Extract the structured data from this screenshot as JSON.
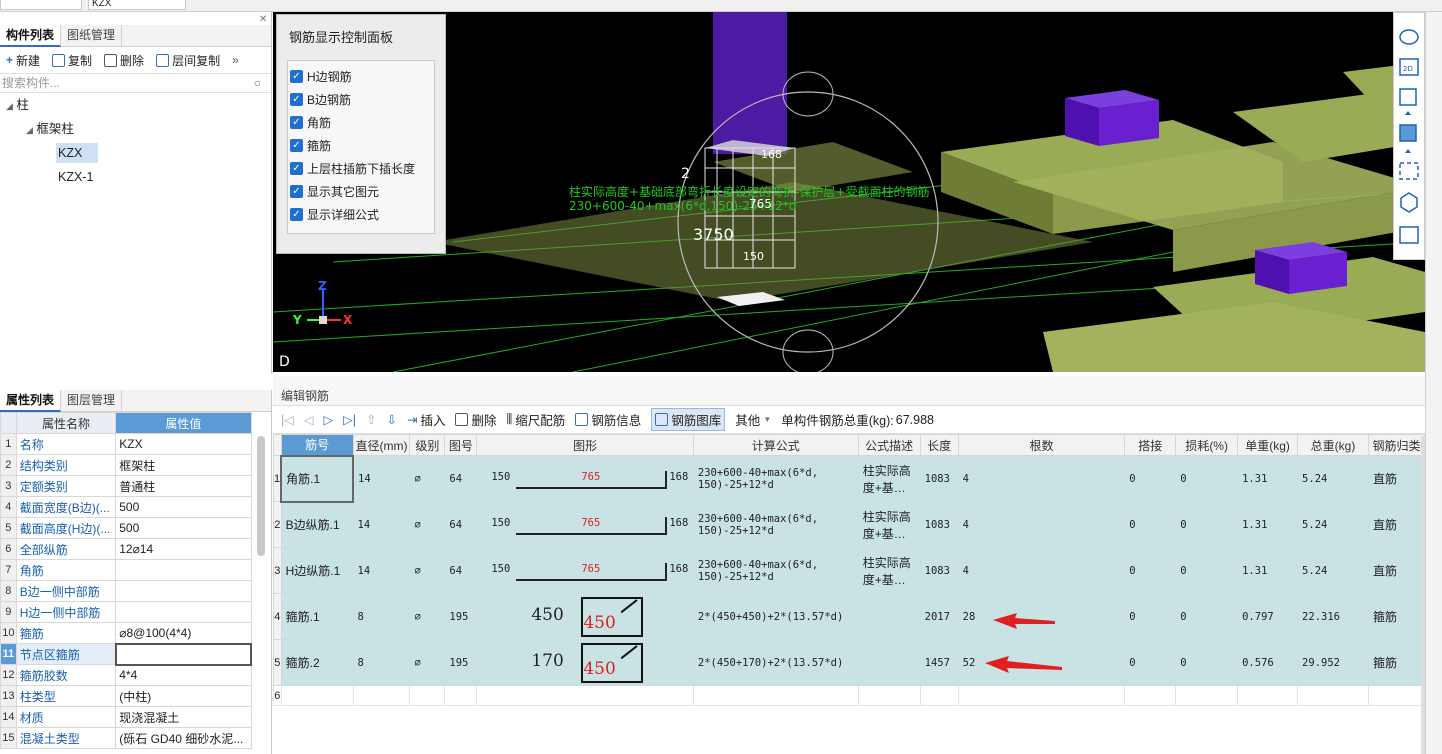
{
  "top": {
    "selector_value": "KZX"
  },
  "component_panel": {
    "tabs": [
      "构件列表",
      "图纸管理"
    ],
    "toolbar": {
      "new": "新建",
      "copy": "复制",
      "delete": "删除",
      "floor_copy": "层间复制"
    },
    "search_placeholder": "搜索构件...",
    "tree": {
      "root": "柱",
      "group": "框架柱",
      "items": [
        "KZX",
        "KZX-1"
      ]
    }
  },
  "control_panel": {
    "title": "钢筋显示控制面板",
    "options": [
      "H边钢筋",
      "B边钢筋",
      "角筋",
      "箍筋",
      "上层柱插筋下插长度",
      "显示其它图元",
      "显示详细公式"
    ]
  },
  "viewport": {
    "annotation_line1": "柱实际高度+基础底部弯折长度设定的弯折-保护层+受截面柱的钢筋",
    "annotation_line2": "230+600-40+max(6*d,150)-25+12*d",
    "dim_3750": "3750",
    "dim_765": "765",
    "dim_168": "168",
    "dim_150": "150",
    "dim_2": "2",
    "axis_x": "X",
    "axis_y": "Y",
    "axis_z": "Z",
    "corner_d": "D"
  },
  "props_panel": {
    "tabs": [
      "属性列表",
      "图层管理"
    ],
    "headers": [
      "属性名称",
      "属性值"
    ],
    "rows": [
      [
        "1",
        "名称",
        "KZX"
      ],
      [
        "2",
        "结构类别",
        "框架柱"
      ],
      [
        "3",
        "定额类别",
        "普通柱"
      ],
      [
        "4",
        "截面宽度(B边)(...",
        "500"
      ],
      [
        "5",
        "截面高度(H边)(...",
        "500"
      ],
      [
        "6",
        "全部纵筋",
        "12⌀14"
      ],
      [
        "7",
        "角筋",
        ""
      ],
      [
        "8",
        "B边一侧中部筋",
        ""
      ],
      [
        "9",
        "H边一侧中部筋",
        ""
      ],
      [
        "10",
        "箍筋",
        "⌀8@100(4*4)"
      ],
      [
        "11",
        "节点区箍筋",
        ""
      ],
      [
        "12",
        "箍筋胶数",
        "4*4"
      ],
      [
        "13",
        "柱类型",
        "(中柱)"
      ],
      [
        "14",
        "材质",
        "现浇混凝土"
      ],
      [
        "15",
        "混凝土类型",
        "(砾石 GD40 细砂水泥..."
      ]
    ]
  },
  "rebar_editor": {
    "title": "编辑钢筋",
    "toolbar": {
      "insert": "插入",
      "delete": "删除",
      "scale": "缩尺配筋",
      "info": "钢筋信息",
      "library": "钢筋图库",
      "other": "其他",
      "total_label": "单构件钢筋总重(kg):",
      "total_value": "67.988"
    },
    "headers": [
      "筋号",
      "直径(mm)",
      "级别",
      "图号",
      "图形",
      "计算公式",
      "公式描述",
      "长度",
      "根数",
      "搭接",
      "损耗(%)",
      "单重(kg)",
      "总重(kg)",
      "钢筋归类"
    ],
    "rows": [
      {
        "idx": "1",
        "name": "角筋.1",
        "dia": "14",
        "grade": "⌀",
        "fig": "64",
        "s_left": "150",
        "s_mid": "765",
        "s_right": "168",
        "formula": "230+600-40+max(6*d,\n150)-25+12*d",
        "desc": "柱实际高\n度+基…",
        "len": "1083",
        "count": "4",
        "lap": "0",
        "loss": "0",
        "unit": "1.31",
        "total": "5.24",
        "cat": "直筋"
      },
      {
        "idx": "2",
        "name": "B边纵筋.1",
        "dia": "14",
        "grade": "⌀",
        "fig": "64",
        "s_left": "150",
        "s_mid": "765",
        "s_right": "168",
        "formula": "230+600-40+max(6*d,\n150)-25+12*d",
        "desc": "柱实际高\n度+基…",
        "len": "1083",
        "count": "4",
        "lap": "0",
        "loss": "0",
        "unit": "1.31",
        "total": "5.24",
        "cat": "直筋"
      },
      {
        "idx": "3",
        "name": "H边纵筋.1",
        "dia": "14",
        "grade": "⌀",
        "fig": "64",
        "s_left": "150",
        "s_mid": "765",
        "s_right": "168",
        "formula": "230+600-40+max(6*d,\n150)-25+12*d",
        "desc": "柱实际高\n度+基…",
        "len": "1083",
        "count": "4",
        "lap": "0",
        "loss": "0",
        "unit": "1.31",
        "total": "5.24",
        "cat": "直筋"
      },
      {
        "idx": "4",
        "name": "箍筋.1",
        "dia": "8",
        "grade": "⌀",
        "fig": "195",
        "s_left": "450",
        "s_mid": "450",
        "s_right": "",
        "formula": "2*(450+450)+2*(13.57*d)",
        "desc": "",
        "len": "2017",
        "count": "28",
        "lap": "0",
        "loss": "0",
        "unit": "0.797",
        "total": "22.316",
        "cat": "箍筋"
      },
      {
        "idx": "5",
        "name": "箍筋.2",
        "dia": "8",
        "grade": "⌀",
        "fig": "195",
        "s_left": "170",
        "s_mid": "450",
        "s_right": "",
        "formula": "2*(450+170)+2*(13.57*d)",
        "desc": "",
        "len": "1457",
        "count": "52",
        "lap": "0",
        "loss": "0",
        "unit": "0.576",
        "total": "29.952",
        "cat": "箍筋"
      }
    ],
    "empty_idx": "6"
  },
  "colors": {
    "accent": "#5b9bd5",
    "row_bg": "#c9e2e3",
    "slab": "#8b9a4a",
    "column": "#6a1fd0",
    "arrow": "#e02020"
  }
}
